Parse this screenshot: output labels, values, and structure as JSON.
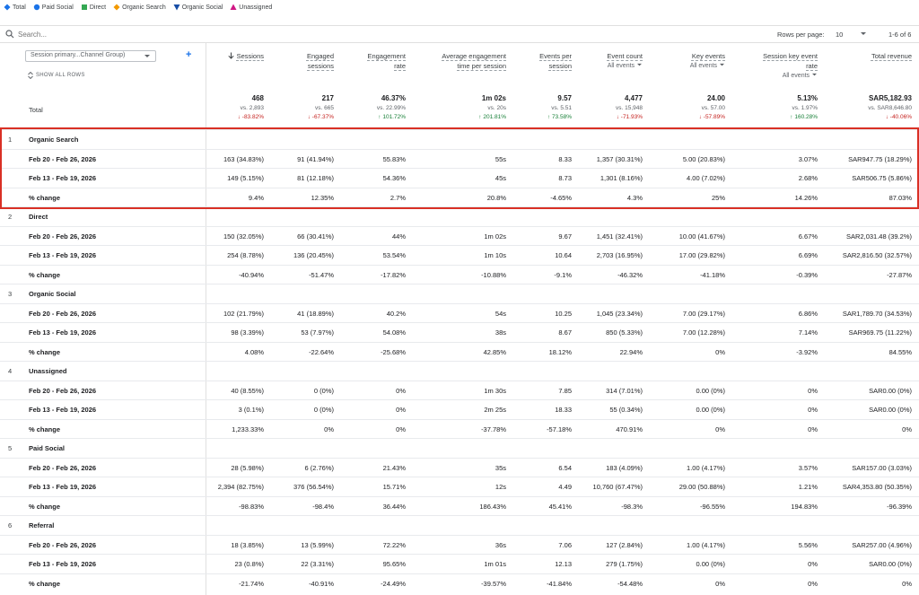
{
  "legend": [
    {
      "label": "Total",
      "icon": "diamond-icon",
      "color": "#1a73e8"
    },
    {
      "label": "Paid Social",
      "icon": "circle-icon",
      "color": "#1a73e8"
    },
    {
      "label": "Direct",
      "icon": "square-icon",
      "color": "#34a853"
    },
    {
      "label": "Organic Search",
      "icon": "diamond-icon",
      "color": "#f29900"
    },
    {
      "label": "Organic Social",
      "icon": "triangle-down-icon",
      "color": "#174ea6"
    },
    {
      "label": "Unassigned",
      "icon": "triangle-up-icon",
      "color": "#d01884"
    }
  ],
  "search": {
    "placeholder": "Search..."
  },
  "pagination": {
    "rows_per_page_label": "Rows per page:",
    "rows_per_page": "10",
    "range": "1-6 of 6"
  },
  "dimension": {
    "selector": "Session primary...Channel Group)",
    "show_all_rows": "SHOW ALL ROWS"
  },
  "columns": [
    {
      "line1": "Sessions",
      "line2": "",
      "sub": "",
      "sorted": true
    },
    {
      "line1": "Engaged",
      "line2": "sessions",
      "sub": ""
    },
    {
      "line1": "Engagement",
      "line2": "rate",
      "sub": ""
    },
    {
      "line1": "Average engagement",
      "line2": "time per session",
      "sub": ""
    },
    {
      "line1": "Events per",
      "line2": "session",
      "sub": ""
    },
    {
      "line1": "Event count",
      "line2": "",
      "sub": "All events"
    },
    {
      "line1": "Key events",
      "line2": "",
      "sub": "All events"
    },
    {
      "line1": "Session key event",
      "line2": "rate",
      "sub": "All events"
    },
    {
      "line1": "Total revenue",
      "line2": "",
      "sub": ""
    }
  ],
  "totals": {
    "label": "Total",
    "cells": [
      {
        "value": "468",
        "compare": "vs. 2,893",
        "delta": "↓ -83.82%",
        "dir": "neg"
      },
      {
        "value": "217",
        "compare": "vs. 665",
        "delta": "↓ -67.37%",
        "dir": "neg"
      },
      {
        "value": "46.37%",
        "compare": "vs. 22.99%",
        "delta": "↑ 101.72%",
        "dir": "pos"
      },
      {
        "value": "1m 02s",
        "compare": "vs. 20s",
        "delta": "↑ 201.81%",
        "dir": "pos"
      },
      {
        "value": "9.57",
        "compare": "vs. 5.51",
        "delta": "↑ 73.58%",
        "dir": "pos"
      },
      {
        "value": "4,477",
        "compare": "vs. 15,948",
        "delta": "↓ -71.93%",
        "dir": "neg"
      },
      {
        "value": "24.00",
        "compare": "vs. 57.00",
        "delta": "↓ -57.89%",
        "dir": "neg"
      },
      {
        "value": "5.13%",
        "compare": "vs. 1.97%",
        "delta": "↑ 160.28%",
        "dir": "pos"
      },
      {
        "value": "SAR5,182.93",
        "compare": "vs. SAR8,646.80",
        "delta": "↓ -40.06%",
        "dir": "neg"
      }
    ]
  },
  "groups": [
    {
      "num": "1",
      "name": "Organic Search",
      "rows": [
        {
          "label": "Feb 20 - Feb 26, 2026",
          "cells": [
            "163 (34.83%)",
            "91 (41.94%)",
            "55.83%",
            "55s",
            "8.33",
            "1,357 (30.31%)",
            "5.00 (20.83%)",
            "3.07%",
            "SAR947.75 (18.29%)"
          ]
        },
        {
          "label": "Feb 13 - Feb 19, 2026",
          "cells": [
            "149 (5.15%)",
            "81 (12.18%)",
            "54.36%",
            "45s",
            "8.73",
            "1,301 (8.16%)",
            "4.00 (7.02%)",
            "2.68%",
            "SAR506.75 (5.86%)"
          ]
        },
        {
          "label": "% change",
          "cells": [
            "9.4%",
            "12.35%",
            "2.7%",
            "20.8%",
            "-4.65%",
            "4.3%",
            "25%",
            "14.26%",
            "87.03%"
          ]
        }
      ]
    },
    {
      "num": "2",
      "name": "Direct",
      "rows": [
        {
          "label": "Feb 20 - Feb 26, 2026",
          "cells": [
            "150 (32.05%)",
            "66 (30.41%)",
            "44%",
            "1m 02s",
            "9.67",
            "1,451 (32.41%)",
            "10.00 (41.67%)",
            "6.67%",
            "SAR2,031.48 (39.2%)"
          ]
        },
        {
          "label": "Feb 13 - Feb 19, 2026",
          "cells": [
            "254 (8.78%)",
            "136 (20.45%)",
            "53.54%",
            "1m 10s",
            "10.64",
            "2,703 (16.95%)",
            "17.00 (29.82%)",
            "6.69%",
            "SAR2,816.50 (32.57%)"
          ]
        },
        {
          "label": "% change",
          "cells": [
            "-40.94%",
            "-51.47%",
            "-17.82%",
            "-10.88%",
            "-9.1%",
            "-46.32%",
            "-41.18%",
            "-0.39%",
            "-27.87%"
          ]
        }
      ]
    },
    {
      "num": "3",
      "name": "Organic Social",
      "rows": [
        {
          "label": "Feb 20 - Feb 26, 2026",
          "cells": [
            "102 (21.79%)",
            "41 (18.89%)",
            "40.2%",
            "54s",
            "10.25",
            "1,045 (23.34%)",
            "7.00 (29.17%)",
            "6.86%",
            "SAR1,789.70 (34.53%)"
          ]
        },
        {
          "label": "Feb 13 - Feb 19, 2026",
          "cells": [
            "98 (3.39%)",
            "53 (7.97%)",
            "54.08%",
            "38s",
            "8.67",
            "850 (5.33%)",
            "7.00 (12.28%)",
            "7.14%",
            "SAR969.75 (11.22%)"
          ]
        },
        {
          "label": "% change",
          "cells": [
            "4.08%",
            "-22.64%",
            "-25.68%",
            "42.85%",
            "18.12%",
            "22.94%",
            "0%",
            "-3.92%",
            "84.55%"
          ]
        }
      ]
    },
    {
      "num": "4",
      "name": "Unassigned",
      "rows": [
        {
          "label": "Feb 20 - Feb 26, 2026",
          "cells": [
            "40 (8.55%)",
            "0 (0%)",
            "0%",
            "1m 30s",
            "7.85",
            "314 (7.01%)",
            "0.00 (0%)",
            "0%",
            "SAR0.00 (0%)"
          ]
        },
        {
          "label": "Feb 13 - Feb 19, 2026",
          "cells": [
            "3 (0.1%)",
            "0 (0%)",
            "0%",
            "2m 25s",
            "18.33",
            "55 (0.34%)",
            "0.00 (0%)",
            "0%",
            "SAR0.00 (0%)"
          ]
        },
        {
          "label": "% change",
          "cells": [
            "1,233.33%",
            "0%",
            "0%",
            "-37.78%",
            "-57.18%",
            "470.91%",
            "0%",
            "0%",
            "0%"
          ]
        }
      ]
    },
    {
      "num": "5",
      "name": "Paid Social",
      "rows": [
        {
          "label": "Feb 20 - Feb 26, 2026",
          "cells": [
            "28 (5.98%)",
            "6 (2.76%)",
            "21.43%",
            "35s",
            "6.54",
            "183 (4.09%)",
            "1.00 (4.17%)",
            "3.57%",
            "SAR157.00 (3.03%)"
          ]
        },
        {
          "label": "Feb 13 - Feb 19, 2026",
          "cells": [
            "2,394 (82.75%)",
            "376 (56.54%)",
            "15.71%",
            "12s",
            "4.49",
            "10,760 (67.47%)",
            "29.00 (50.88%)",
            "1.21%",
            "SAR4,353.80 (50.35%)"
          ]
        },
        {
          "label": "% change",
          "cells": [
            "-98.83%",
            "-98.4%",
            "36.44%",
            "186.43%",
            "45.41%",
            "-98.3%",
            "-96.55%",
            "194.83%",
            "-96.39%"
          ]
        }
      ]
    },
    {
      "num": "6",
      "name": "Referral",
      "rows": [
        {
          "label": "Feb 20 - Feb 26, 2026",
          "cells": [
            "18 (3.85%)",
            "13 (5.99%)",
            "72.22%",
            "36s",
            "7.06",
            "127 (2.84%)",
            "1.00 (4.17%)",
            "5.56%",
            "SAR257.00 (4.96%)"
          ]
        },
        {
          "label": "Feb 13 - Feb 19, 2026",
          "cells": [
            "23 (0.8%)",
            "22 (3.31%)",
            "95.65%",
            "1m 01s",
            "12.13",
            "279 (1.75%)",
            "0.00 (0%)",
            "0%",
            "SAR0.00 (0%)"
          ]
        },
        {
          "label": "% change",
          "cells": [
            "-21.74%",
            "-40.91%",
            "-24.49%",
            "-39.57%",
            "-41.84%",
            "-54.48%",
            "0%",
            "0%",
            "0%"
          ]
        }
      ]
    }
  ]
}
